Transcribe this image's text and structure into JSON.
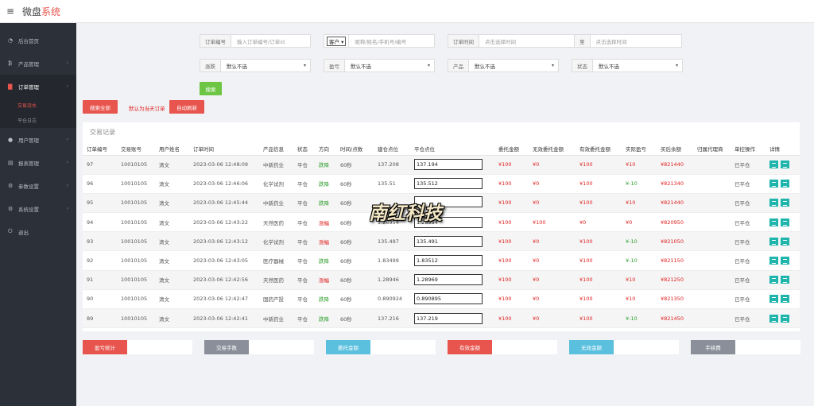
{
  "app": {
    "title_main": "微盘",
    "title_accent": "系统"
  },
  "sidebar": {
    "items": [
      {
        "label": "后台首页",
        "icon": "dashboard-icon",
        "glyph": "◔"
      },
      {
        "label": "产品管理",
        "icon": "bitcoin-icon",
        "glyph": "₿"
      },
      {
        "label": "订单管理",
        "icon": "folder-icon",
        "glyph": "▇"
      },
      {
        "label": "用户管理",
        "icon": "user-icon",
        "glyph": "●"
      },
      {
        "label": "报表管理",
        "icon": "report-icon",
        "glyph": "▤"
      },
      {
        "label": "参数设置",
        "icon": "gear-icon",
        "glyph": "⚙"
      },
      {
        "label": "系统设置",
        "icon": "settings-icon",
        "glyph": "⚙"
      },
      {
        "label": "退出",
        "icon": "power-icon",
        "glyph": "⏻"
      }
    ],
    "subitems": [
      "交易流水",
      "平仓日志"
    ]
  },
  "filters": {
    "order_no": {
      "label": "订单编号",
      "placeholder": "输入订单编号/订单id"
    },
    "client": {
      "select": "客户",
      "placeholder": "昵称/姓名/手机号/编号"
    },
    "order_time": {
      "label": "订单时间",
      "placeholder": "点击选择时间",
      "sep": "至",
      "placeholder2": "点击选择时间"
    },
    "rise_fall": {
      "label": "涨跌",
      "value": "默认不选"
    },
    "profit": {
      "label": "盈亏",
      "value": "默认不选"
    },
    "product": {
      "label": "产品",
      "value": "默认不选"
    },
    "status": {
      "label": "状态",
      "value": "默认不选"
    },
    "search_btn": "搜索"
  },
  "actions": {
    "search_all": "搜索全部",
    "default_today": "默认为当天订单",
    "auto_refresh": "自动刷新"
  },
  "panel": {
    "title": "交易记录"
  },
  "table": {
    "headers": [
      "订单编号",
      "交易账号",
      "用户姓名",
      "订单时间",
      "产品信息",
      "状态",
      "方向",
      "时间/点数",
      "建仓点位",
      "平仓点位",
      "委托金额",
      "无效委托金额",
      "有效委托金额",
      "实际盈亏",
      "买后余额",
      "归属代理商",
      "单控操作",
      "详情"
    ],
    "rows": [
      [
        "97",
        "10010105",
        "清文",
        "2023-03-06 12:48:09",
        "中新药业",
        "平仓",
        "跌降",
        "60秒",
        "137.208",
        "137.194",
        "¥100",
        "¥0",
        "¥100",
        "¥10",
        "¥821440",
        "",
        "已平仓"
      ],
      [
        "96",
        "10010105",
        "清文",
        "2023-03-06 12:46:06",
        "化学试剂",
        "平仓",
        "跌降",
        "60秒",
        "135.51",
        "135.512",
        "¥100",
        "¥0",
        "¥100",
        "¥-10",
        "¥821340",
        "",
        "已平仓"
      ],
      [
        "95",
        "10010105",
        "清文",
        "2023-03-06 12:45:44",
        "中新药业",
        "平仓",
        "跌降",
        "60秒",
        "",
        "",
        "¥100",
        "¥0",
        "¥100",
        "¥10",
        "¥821440",
        "",
        "已平仓"
      ],
      [
        "94",
        "10010105",
        "清文",
        "2023-03-06 12:43:22",
        "天然医药",
        "平仓",
        "涨幅",
        "60秒",
        "1.28954",
        "1.28954",
        "¥100",
        "¥100",
        "¥0",
        "¥0",
        "¥820950",
        "",
        "已平仓"
      ],
      [
        "93",
        "10010105",
        "清文",
        "2023-03-06 12:43:12",
        "化学试剂",
        "平仓",
        "涨幅",
        "60秒",
        "135.497",
        "135.491",
        "¥100",
        "¥0",
        "¥100",
        "¥-10",
        "¥821050",
        "",
        "已平仓"
      ],
      [
        "92",
        "10010105",
        "清文",
        "2023-03-06 12:43:05",
        "医疗器械",
        "平仓",
        "跌降",
        "60秒",
        "1.83499",
        "1.83512",
        "¥100",
        "¥0",
        "¥100",
        "¥-10",
        "¥821150",
        "",
        "已平仓"
      ],
      [
        "91",
        "10010105",
        "清文",
        "2023-03-06 12:42:56",
        "天然医药",
        "平仓",
        "涨幅",
        "60秒",
        "1.28946",
        "1.28969",
        "¥100",
        "¥0",
        "¥100",
        "¥10",
        "¥821250",
        "",
        "已平仓"
      ],
      [
        "90",
        "10010105",
        "清文",
        "2023-03-06 12:42:47",
        "国药产投",
        "平仓",
        "跌降",
        "60秒",
        "0.890924",
        "0.890895",
        "¥100",
        "¥0",
        "¥100",
        "¥10",
        "¥821350",
        "",
        "已平仓"
      ],
      [
        "89",
        "10010105",
        "清文",
        "2023-03-06 12:42:41",
        "中新药业",
        "平仓",
        "跌降",
        "60秒",
        "137.216",
        "137.219",
        "¥100",
        "¥0",
        "¥100",
        "¥-10",
        "¥821450",
        "",
        "已平仓"
      ]
    ]
  },
  "stats": [
    {
      "label": "盈亏统计",
      "color": "#e8554e"
    },
    {
      "label": "交易手数",
      "color": "#8a8f99"
    },
    {
      "label": "委托金额",
      "color": "#5bc0de"
    },
    {
      "label": "有效金额",
      "color": "#e8554e"
    },
    {
      "label": "无效金额",
      "color": "#5bc0de"
    },
    {
      "label": "手续费",
      "color": "#8a8f99"
    }
  ],
  "watermark": "南红科技",
  "colors": {
    "red": "#e8554e",
    "green": "#6cc644",
    "sidebar": "#2c3038",
    "teal": "#1fb5ad"
  }
}
